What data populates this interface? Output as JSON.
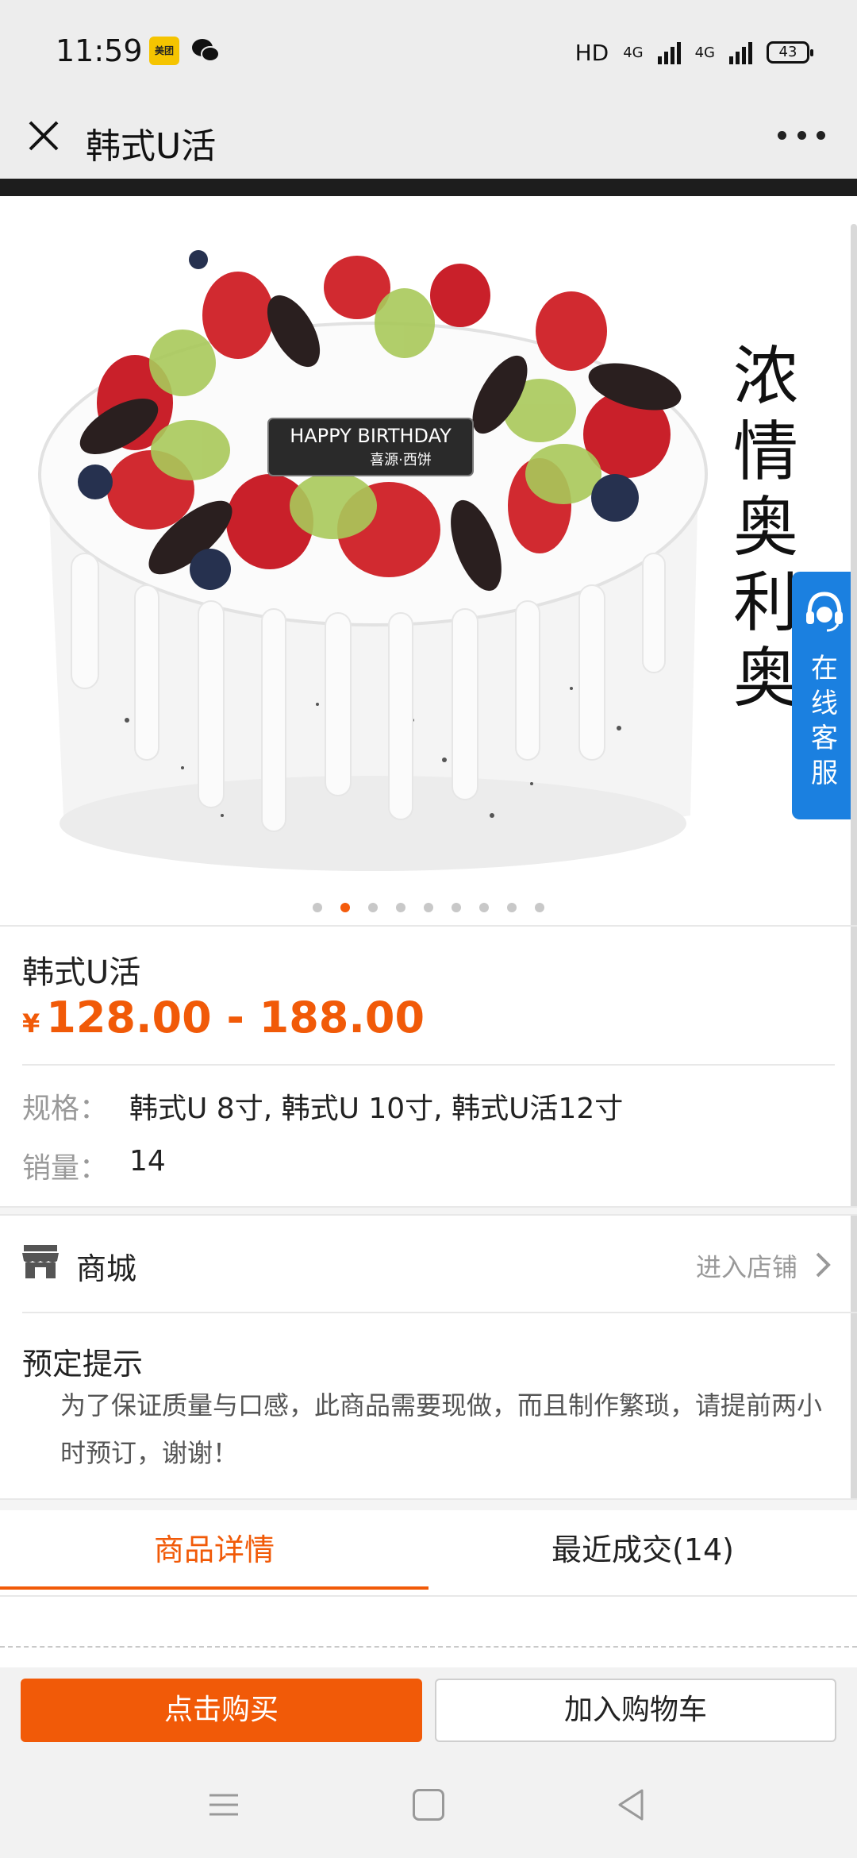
{
  "status_bar": {
    "time": "11:59",
    "meituan_icon_text": "美团",
    "network_label": "HD",
    "signal_1": "4G",
    "signal_2": "4G",
    "battery": "43"
  },
  "title_bar": {
    "title": "韩式U活"
  },
  "carousel": {
    "cake_plaque_text": "HAPPY BIRTHDAY",
    "cake_plaque_sub": "喜源·西饼",
    "vertical_text": "浓情奥利奥",
    "service_badge_text": "在线客服",
    "slide_count": 9,
    "active_slide": 2
  },
  "product": {
    "name": "韩式U活",
    "currency": "¥",
    "price": "128.00 - 188.00",
    "spec_label": "规格：",
    "spec_value": "韩式U 8寸, 韩式U 10寸, 韩式U活12寸",
    "sales_label": "销量：",
    "sales_value": "14"
  },
  "shop": {
    "label": "商城",
    "enter_label": "进入店铺"
  },
  "notice": {
    "title": "预定提示",
    "text": "为了保证质量与口感，此商品需要现做，而且制作繁琐，请提前两小时预订，谢谢！"
  },
  "tabs": {
    "details": "商品详情",
    "recent": "最近成交(14)"
  },
  "actions": {
    "buy": "点击购买",
    "cart": "加入购物车"
  },
  "colors": {
    "accent": "#f15a08",
    "service_blue": "#1b80e0"
  }
}
